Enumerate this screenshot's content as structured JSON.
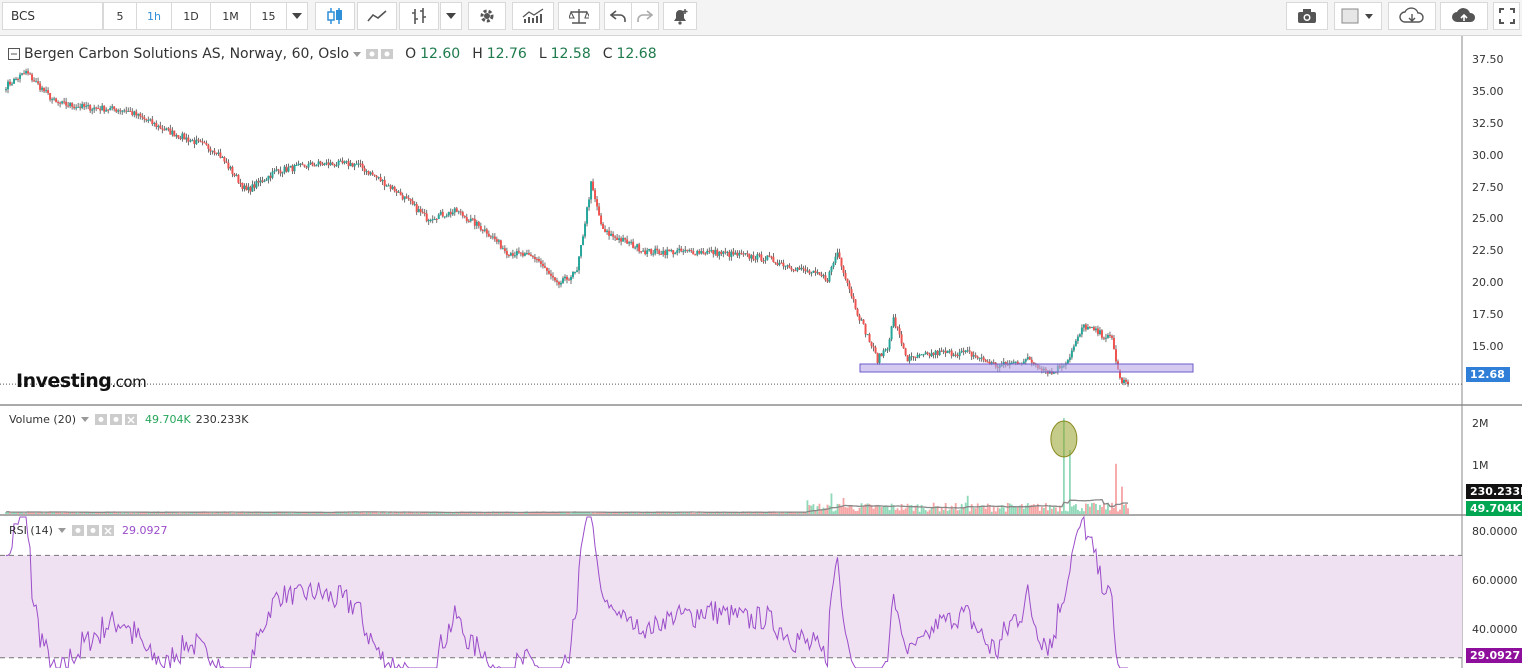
{
  "toolbar": {
    "symbol": "BCS",
    "intervals": [
      "5",
      "1h",
      "1D",
      "1M",
      "15"
    ],
    "active_interval": "1h"
  },
  "main_legend": {
    "title": "Bergen Carbon Solutions AS, Norway, 60, Oslo",
    "open_label": "O",
    "open": "12.60",
    "high_label": "H",
    "high": "12.76",
    "low_label": "L",
    "low": "12.58",
    "close_label": "C",
    "close": "12.68"
  },
  "price_axis": [
    "37.50",
    "35.00",
    "32.50",
    "30.00",
    "27.50",
    "25.00",
    "22.50",
    "20.00",
    "17.50",
    "15.00"
  ],
  "last_price": "12.68",
  "logo": {
    "main": "Investing",
    "suffix": ".com"
  },
  "volume": {
    "label": "Volume (20)",
    "value1": "49.704K",
    "value2": "230.233K",
    "axis": [
      "2M",
      "1M"
    ],
    "tag_ma": "230.233K",
    "tag_vol": "49.704K"
  },
  "rsi": {
    "label": "RSI (14)",
    "value": "29.0927",
    "axis": [
      "80.0000",
      "60.0000",
      "40.0000"
    ],
    "tag": "29.0927"
  },
  "colors": {
    "up": "#26a69a",
    "down": "#ef5350",
    "rsi_line": "#9b4dca",
    "rsi_band": "#efe0f2",
    "support": "#b9a9e6",
    "tag_price": "#2f7fd8",
    "tag_volume": "#00a651",
    "tag_rsi": "#8e0f9b"
  },
  "chart_data": {
    "type": "candlestick",
    "title": "Bergen Carbon Solutions AS, Norway, 60, Oslo",
    "price_waypoints": [
      {
        "i": 0,
        "p": 34.8
      },
      {
        "i": 10,
        "p": 35.8
      },
      {
        "i": 25,
        "p": 33.5
      },
      {
        "i": 40,
        "p": 33.2
      },
      {
        "i": 60,
        "p": 33.0
      },
      {
        "i": 80,
        "p": 31.5
      },
      {
        "i": 105,
        "p": 30.0
      },
      {
        "i": 120,
        "p": 27.0
      },
      {
        "i": 135,
        "p": 28.5
      },
      {
        "i": 155,
        "p": 29.0
      },
      {
        "i": 175,
        "p": 29.0
      },
      {
        "i": 195,
        "p": 27.0
      },
      {
        "i": 210,
        "p": 25.0
      },
      {
        "i": 225,
        "p": 25.5
      },
      {
        "i": 240,
        "p": 24.0
      },
      {
        "i": 250,
        "p": 22.5
      },
      {
        "i": 265,
        "p": 22.0
      },
      {
        "i": 275,
        "p": 20.0
      },
      {
        "i": 285,
        "p": 21.0
      },
      {
        "i": 292,
        "p": 27.5
      },
      {
        "i": 298,
        "p": 24.0
      },
      {
        "i": 320,
        "p": 22.5
      },
      {
        "i": 350,
        "p": 22.5
      },
      {
        "i": 380,
        "p": 22.0
      },
      {
        "i": 400,
        "p": 21.0
      },
      {
        "i": 410,
        "p": 20.5
      },
      {
        "i": 415,
        "p": 22.5
      },
      {
        "i": 425,
        "p": 18.0
      },
      {
        "i": 435,
        "p": 14.5
      },
      {
        "i": 440,
        "p": 15.5
      },
      {
        "i": 443,
        "p": 17.5
      },
      {
        "i": 450,
        "p": 14.5
      },
      {
        "i": 465,
        "p": 15.0
      },
      {
        "i": 480,
        "p": 15.0
      },
      {
        "i": 495,
        "p": 14.0
      },
      {
        "i": 510,
        "p": 14.5
      },
      {
        "i": 522,
        "p": 13.5
      },
      {
        "i": 530,
        "p": 14.5
      },
      {
        "i": 538,
        "p": 17.0
      },
      {
        "i": 552,
        "p": 16.0
      },
      {
        "i": 556,
        "p": 13.0
      },
      {
        "i": 560,
        "p": 12.68
      }
    ],
    "volume_spikes": [
      {
        "i": 400,
        "v": 0.3
      },
      {
        "i": 412,
        "v": 0.45
      },
      {
        "i": 418,
        "v": 0.35
      },
      {
        "i": 480,
        "v": 0.4
      },
      {
        "i": 528,
        "v": 2.1
      },
      {
        "i": 531,
        "v": 1.4
      },
      {
        "i": 554,
        "v": 1.1
      },
      {
        "i": 557,
        "v": 0.6
      }
    ],
    "rsi_overbought": 70,
    "rsi_oversold": 30,
    "price_ylim": [
      11.8,
      38.2
    ],
    "volume_ylim": [
      0,
      2.3
    ],
    "rsi_ylim": [
      26,
      85
    ]
  }
}
